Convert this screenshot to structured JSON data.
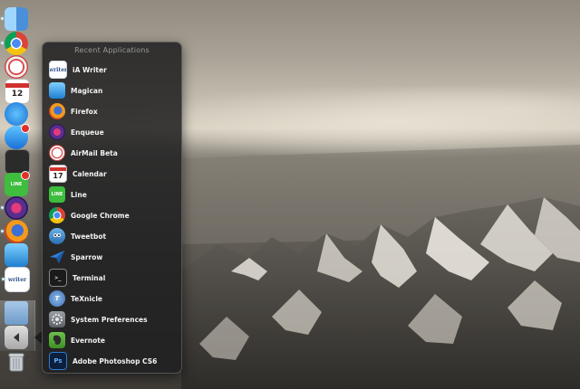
{
  "stack_panel": {
    "title": "Recent Applications",
    "apps": [
      {
        "label": "iA Writer",
        "icon": "ia-writer-icon",
        "glyph": "writer"
      },
      {
        "label": "Magican",
        "icon": "magican-icon",
        "glyph": ""
      },
      {
        "label": "Firefox",
        "icon": "firefox-icon",
        "glyph": ""
      },
      {
        "label": "Enqueue",
        "icon": "enqueue-icon",
        "glyph": ""
      },
      {
        "label": "AirMail Beta",
        "icon": "airmail-icon",
        "glyph": ""
      },
      {
        "label": "Calendar",
        "icon": "calendar-icon",
        "glyph": "17"
      },
      {
        "label": "Line",
        "icon": "line-icon",
        "glyph": "LINE"
      },
      {
        "label": "Google Chrome",
        "icon": "chrome-icon",
        "glyph": ""
      },
      {
        "label": "Tweetbot",
        "icon": "tweetbot-icon",
        "glyph": ""
      },
      {
        "label": "Sparrow",
        "icon": "sparrow-icon",
        "glyph": ""
      },
      {
        "label": "Terminal",
        "icon": "terminal-icon",
        "glyph": ">_"
      },
      {
        "label": "TeXnicle",
        "icon": "texnicle-icon",
        "glyph": "T"
      },
      {
        "label": "System Preferences",
        "icon": "system-preferences-icon",
        "glyph": ""
      },
      {
        "label": "Evernote",
        "icon": "evernote-icon",
        "glyph": ""
      },
      {
        "label": "Adobe Photoshop CS6",
        "icon": "photoshop-icon",
        "glyph": "Ps"
      }
    ]
  },
  "dock": {
    "calendar_day": "12",
    "writer_glyph": "writer",
    "line_glyph": "LINE"
  },
  "colors": {
    "panel_background": "#1e1e20",
    "panel_text": "#f2f2f2",
    "panel_title": "#9a9a9a",
    "badge": "#e0302a"
  }
}
